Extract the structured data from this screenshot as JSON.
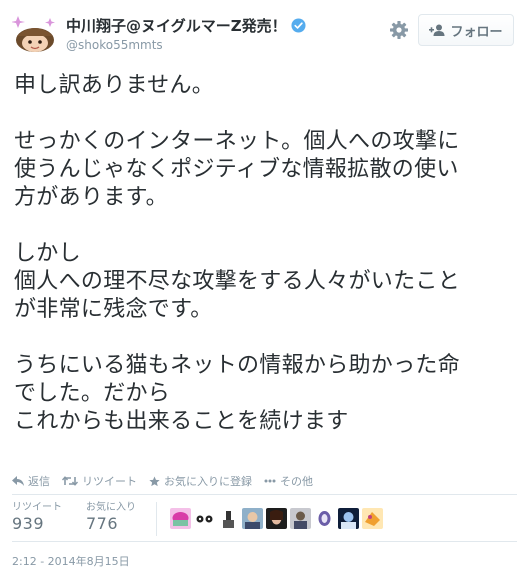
{
  "user": {
    "display_name": "中川翔子@ヌイグルマーZ発売！",
    "handle": "@shoko55mmts",
    "verified": true,
    "avatar_icon": "avatar-image"
  },
  "follow_button": {
    "label": "フォロー",
    "icon": "add-user-icon"
  },
  "tweet": {
    "paragraphs": [
      [
        "申し訳ありません。"
      ],
      [
        "せっかくのインターネット。個人への攻撃に",
        "使うんじゃなくポジティブな情報拡散の使い",
        "方があります。"
      ],
      [
        "しかし",
        "個人への理不尽な攻撃をする人々がいたこと",
        "が非常に残念です。"
      ],
      [
        "うちにいる猫もネットの情報から助かった命",
        "でした。だから",
        "これからも出来ることを続けます"
      ]
    ]
  },
  "actions": {
    "reply": "返信",
    "retweet": "リツイート",
    "favorite": "お気に入りに登録",
    "more": "その他"
  },
  "stats": {
    "retweets_label": "リツイート",
    "retweets_value": "939",
    "favorites_label": "お気に入り",
    "favorites_value": "776"
  },
  "timestamp": "2:12 - 2014年8月15日",
  "colors": {
    "text": "#292f33",
    "muted": "#8899a6",
    "verified_blue": "#55acee",
    "border": "#e1e8ed"
  }
}
